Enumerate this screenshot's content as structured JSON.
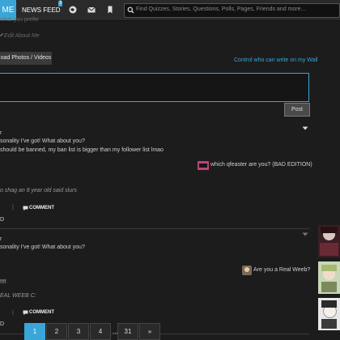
{
  "topbar": {
    "me_label": "ME",
    "news_feed_label": "NEWS FEED",
    "news_badge": "3",
    "search_placeholder": "Find Quizzes, Stories, Questions, Polls, Pages, Friends and more..."
  },
  "wall": {
    "prompt_tail": "what you prefer",
    "edit_about": "Edit About Me",
    "upload_label": "oad Photos / Videos",
    "control_link": "Control who can write on my Wall",
    "post_label": "Post"
  },
  "feed": [
    {
      "author_tail": "r",
      "line1": "sonality I've got! What about you?",
      "line2": "should be banned, my ban list is bigger than my follower list lmao",
      "result": "which qfeaster are you? (BAD EDITION)",
      "comment_text": "o shag an 8 year old said slurs",
      "comment_label": "COMMENT",
      "sep": "|",
      "footer_tail": "D"
    },
    {
      "author_tail": "r",
      "line1": "sonality I've got! What about you?",
      "result": "Are you a Real Weeb?",
      "exclaim": "!!!!",
      "comment_text": "EAL WEEB C:",
      "comment_label": "COMMENT",
      "sep": "|",
      "footer_tail": "D"
    }
  ],
  "pagination": {
    "pages": [
      "1",
      "2",
      "3",
      "4",
      "...",
      "31",
      "»"
    ],
    "current": "1"
  },
  "colors": {
    "accent": "#3aa6d8",
    "background": "#1c1c1c"
  }
}
